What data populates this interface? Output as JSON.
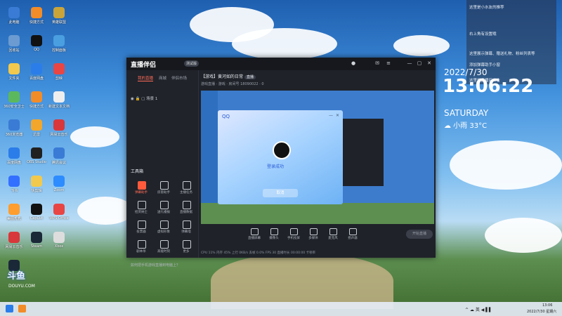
{
  "desktop": {
    "icons": [
      {
        "label": "此电脑",
        "color": "#3a7bd5"
      },
      {
        "label": "快捷方式",
        "color": "#f28c28"
      },
      {
        "label": "英雄联盟",
        "color": "#c9a43a"
      },
      {
        "label": "回收站",
        "color": "#6b9bd1"
      },
      {
        "label": "QQ",
        "color": "#111111"
      },
      {
        "label": "控制面板",
        "color": "#4a9fe0"
      },
      {
        "label": "文件夹",
        "color": "#f2c94c"
      },
      {
        "label": "百度网盘",
        "color": "#2b7de9"
      },
      {
        "label": "剪映",
        "color": "#e84545"
      },
      {
        "label": "360安全卫士",
        "color": "#5cb85c"
      },
      {
        "label": "快捷方式",
        "color": "#f28c28"
      },
      {
        "label": "新建文本文档",
        "color": "#eeeeee"
      },
      {
        "label": "360浏览器",
        "color": "#3a7bd5"
      },
      {
        "label": "迅雷",
        "color": "#f2a62b"
      },
      {
        "label": "网易云音乐",
        "color": "#d8373b"
      },
      {
        "label": "百度网盘",
        "color": "#2b7de9"
      },
      {
        "label": "OBS Studio",
        "color": "#202020"
      },
      {
        "label": "腾讯会议",
        "color": "#3a7bd5"
      },
      {
        "label": "飞书",
        "color": "#3370ff"
      },
      {
        "label": "快剪辑",
        "color": "#f2c94c"
      },
      {
        "label": "Zoom",
        "color": "#2d8cff"
      },
      {
        "label": "美图秀秀",
        "color": "#ff9d2e"
      },
      {
        "label": "CapCut",
        "color": "#111111"
      },
      {
        "label": "WPS Office",
        "color": "#e84545"
      },
      {
        "label": "网易云音乐",
        "color": "#d8373b"
      },
      {
        "label": "Steam",
        "color": "#1b2838"
      },
      {
        "label": "Xbox",
        "color": "#dddddd"
      },
      {
        "label": "Steam",
        "color": "#1b2838"
      }
    ],
    "watermark": "斗鱼",
    "watermark_sub": "DOUYU.COM"
  },
  "widget": {
    "rows": [
      "这里是小水友的推荐",
      "右上角有设置哦",
      "这里展示弹幕、赠送礼物、粉丝列表等",
      "添加弹幕助手小窗",
      "这里是直播间公告"
    ],
    "date": "2022/7/30",
    "time": "13:06:22",
    "day": "SATURDAY",
    "weather": "☁ 小雨 33°C"
  },
  "app": {
    "logo": "直播伴侣",
    "version": "测试版",
    "left_tabs": [
      "我的直播",
      "商城",
      "伴侣市场"
    ],
    "scene_item": "◉ 🔒 ▢ 场景 1",
    "tools_title": "工具箱",
    "tools": [
      {
        "label": "弹幕助手",
        "on": true
      },
      {
        "label": "房管助手",
        "on": false
      },
      {
        "label": "主播任务",
        "on": false
      },
      {
        "label": "招贤纳士",
        "on": false
      },
      {
        "label": "送礼播报",
        "on": false
      },
      {
        "label": "直播数据",
        "on": false
      },
      {
        "label": "投票器",
        "on": false
      },
      {
        "label": "虚拟形象",
        "on": false
      },
      {
        "label": "弹幕墙",
        "on": false
      },
      {
        "label": "剧本杀",
        "on": false
      },
      {
        "label": "高能时刻",
        "on": false
      },
      {
        "label": "更多",
        "on": false
      }
    ],
    "left_footer": "如何把手机游戏直播到电脑上？",
    "header_title": "【游戏】黄河如的日常",
    "header_tag": "直播",
    "header_sub": "游戏直播 · 游戏 · 房间号 18090022 · 0",
    "qq": {
      "logo": "QQ",
      "message": "登录成功",
      "button": "取消"
    },
    "controls": [
      "直播屏幕",
      "摄像头",
      "手机投屏",
      "多媒体",
      "麦克风",
      "扬声器"
    ],
    "start_button": "开始直播",
    "status": "CPU 11%   内存 45%   上行 0KB/s   丢帧 0.0%   FPS 30   直播时长 00:00:00   卡顿率"
  },
  "taskbar": {
    "time": "13:06",
    "date": "2022/7/30 星期六",
    "tray": "^ ☁ 英 ◀ ▌▌"
  }
}
